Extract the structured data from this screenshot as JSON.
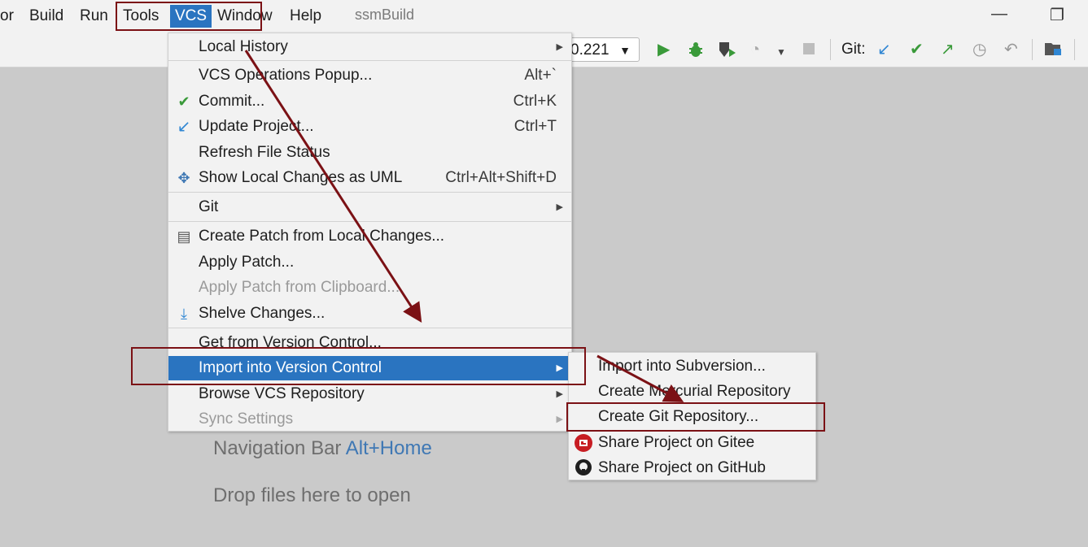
{
  "menubar": {
    "items": [
      "or",
      "Build",
      "Run",
      "Tools",
      "VCS",
      "Window",
      "Help"
    ],
    "project_title": "ssmBuild",
    "minimize_glyph": "—",
    "restore_glyph": "❐"
  },
  "toolbar": {
    "run_config_value": "0.221",
    "git_label": "Git:",
    "icons": [
      "run-icon",
      "debug-icon",
      "coverage-icon",
      "profile-icon",
      "stop-icon",
      "git-update-icon",
      "git-commit-icon",
      "git-push-icon",
      "history-icon",
      "rollback-icon",
      "project-structure-icon"
    ]
  },
  "vcs_menu": {
    "local_history": "Local History",
    "vcs_operations_popup": "VCS Operations Popup...",
    "vcs_operations_shortcut": "Alt+`",
    "commit": "Commit...",
    "commit_shortcut": "Ctrl+K",
    "update_project": "Update Project...",
    "update_shortcut": "Ctrl+T",
    "refresh_file_status": "Refresh File Status",
    "show_local_changes_uml": "Show Local Changes as UML",
    "show_uml_shortcut": "Ctrl+Alt+Shift+D",
    "git": "Git",
    "create_patch": "Create Patch from Local Changes...",
    "apply_patch": "Apply Patch...",
    "apply_patch_clipboard": "Apply Patch from Clipboard...",
    "shelve_changes": "Shelve Changes...",
    "get_from_vc": "Get from Version Control...",
    "import_into_vc": "Import into Version Control",
    "browse_vcs_repository": "Browse VCS Repository",
    "sync_settings": "Sync Settings"
  },
  "import_submenu": {
    "import_into_subversion": "Import into Subversion...",
    "create_mercurial_repository": "Create Mercurial Repository",
    "create_git_repository": "Create Git Repository...",
    "share_on_gitee": "Share Project on Gitee",
    "share_on_github": "Share Project on GitHub"
  },
  "welcome": {
    "navigation_bar_label": "Navigation Bar",
    "navigation_bar_key": "Alt+Home",
    "drop_files": "Drop files here to open"
  },
  "colors": {
    "accent": "#2a74c0",
    "annotation_red": "#7b1115",
    "run_green": "#3a9a3a"
  }
}
